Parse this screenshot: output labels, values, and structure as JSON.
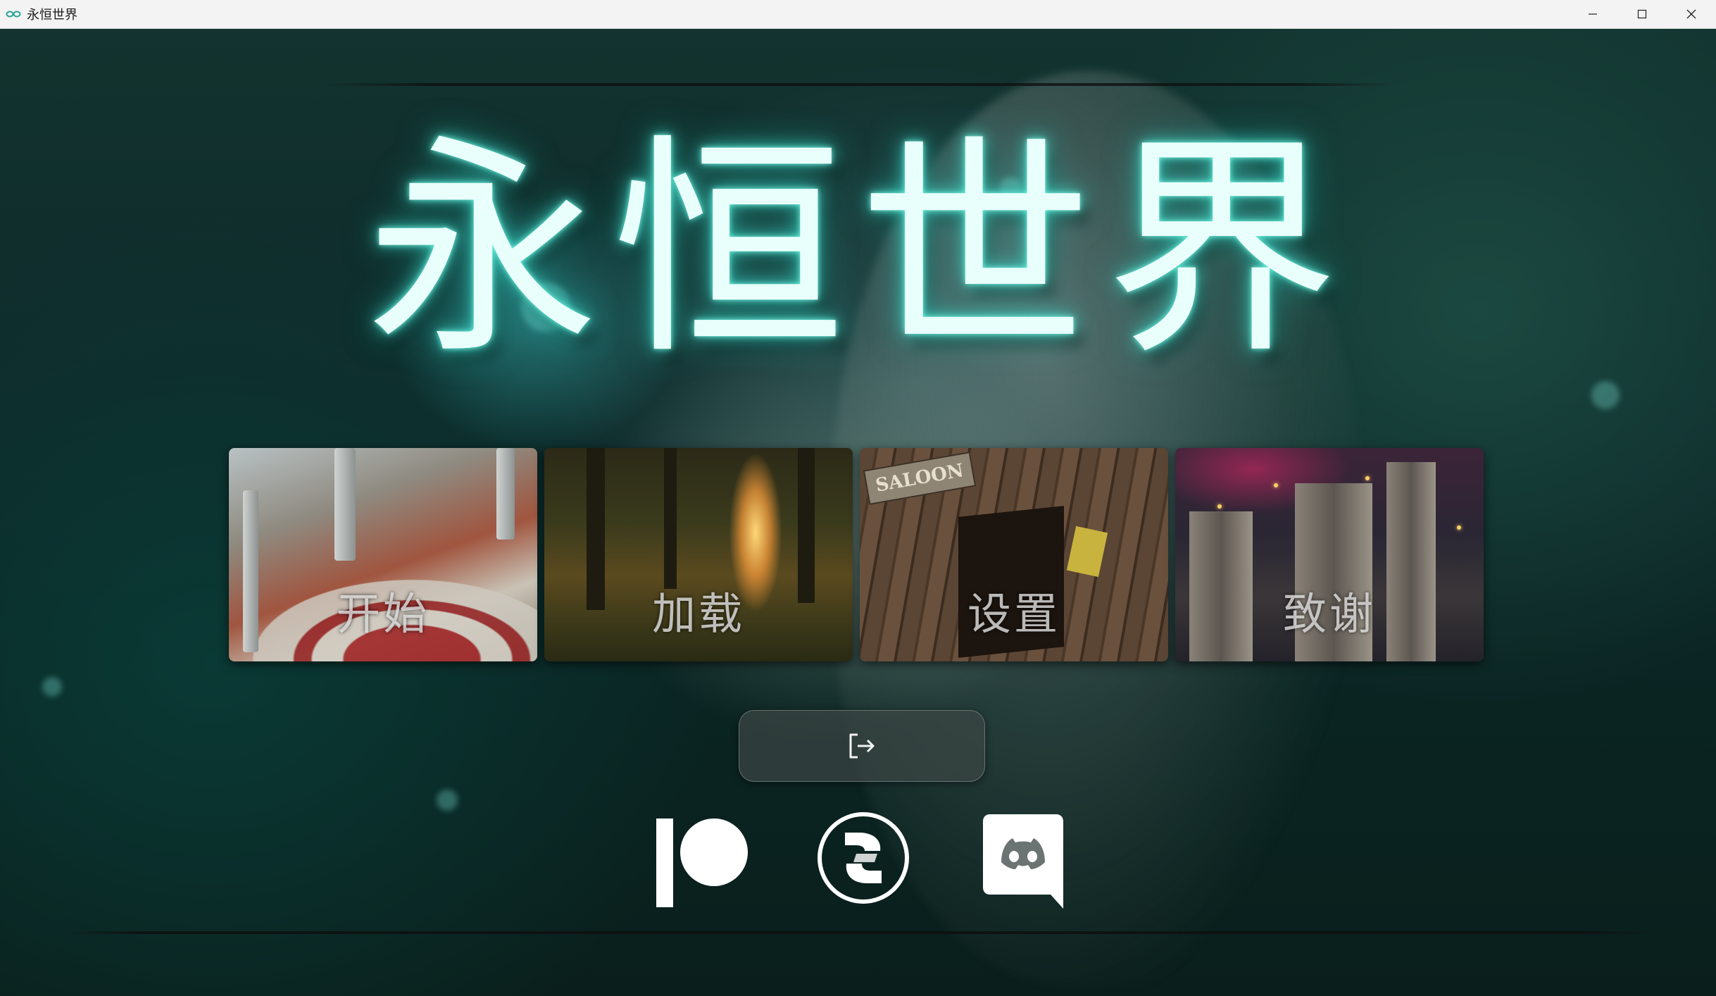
{
  "window": {
    "title": "永恒世界"
  },
  "game": {
    "title": "永恒世界"
  },
  "menu": {
    "items": [
      {
        "label": "开始"
      },
      {
        "label": "加载"
      },
      {
        "label": "设置"
      },
      {
        "label": "致谢"
      }
    ]
  },
  "tiles": {
    "settings_sign_text": "SALOON"
  },
  "exit": {
    "icon": "logout-icon"
  },
  "social": {
    "items": [
      {
        "icon": "patreon-icon"
      },
      {
        "icon": "subscribestar-icon"
      },
      {
        "icon": "discord-icon"
      }
    ]
  },
  "colors": {
    "title_glow": "#5ef0dc",
    "titlebar_bg": "#f3f3f3"
  }
}
